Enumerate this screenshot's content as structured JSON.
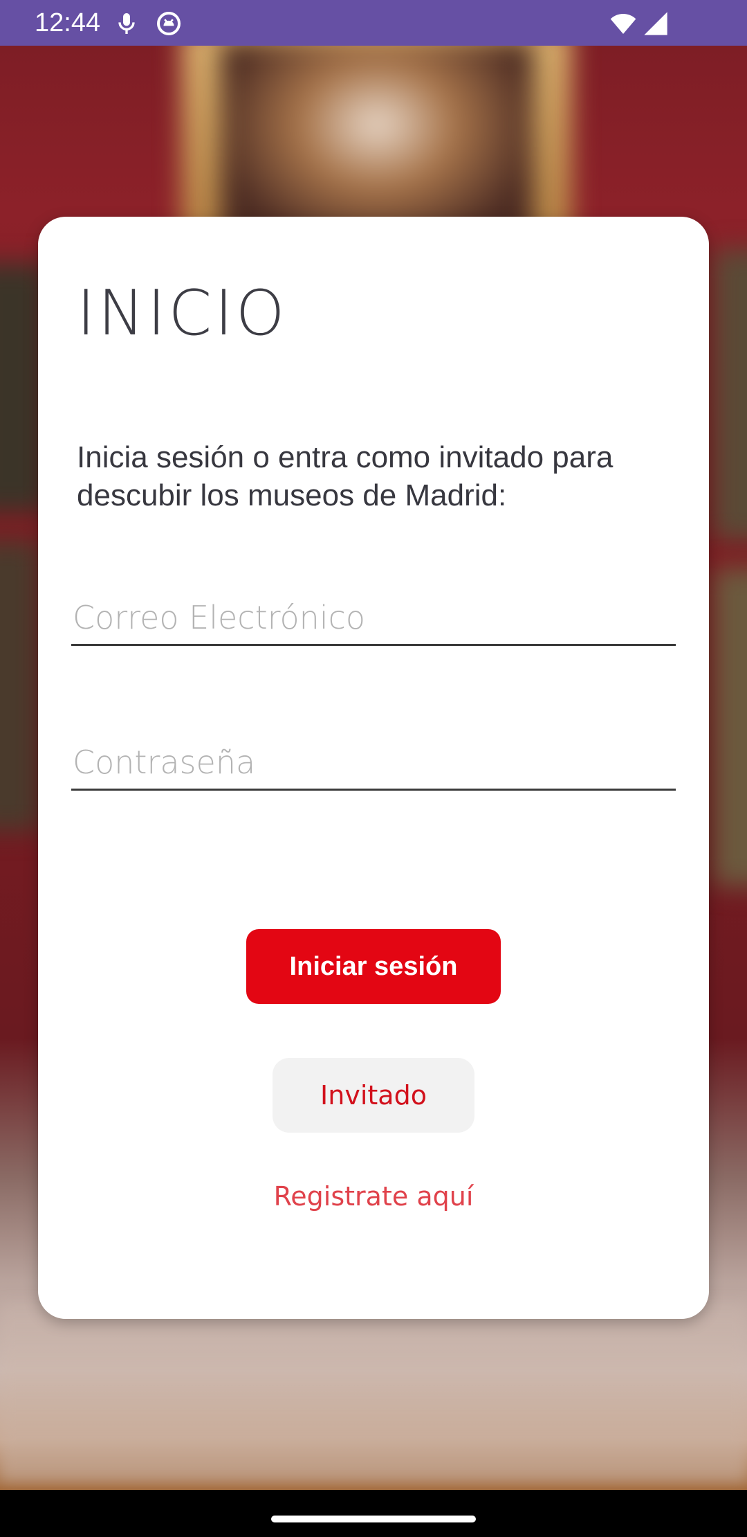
{
  "status_bar": {
    "time": "12:44",
    "bg_color": "#6650a4",
    "icons": [
      "microphone-icon",
      "android-debug-icon",
      "wifi-icon",
      "cellular-signal-icon"
    ]
  },
  "login_card": {
    "title": "INICIO",
    "subtitle": "Inicia sesión o entra como invitado para descubir los museos de Madrid:",
    "email_field": {
      "placeholder": "Correo Electrónico",
      "value": ""
    },
    "password_field": {
      "placeholder": "Contraseña",
      "value": ""
    },
    "login_button_label": "Iniciar sesión",
    "guest_button_label": "Invitado",
    "register_link_label": "Registrate aquí"
  },
  "colors": {
    "primary_red": "#e30613",
    "guest_text_red": "#d2111c",
    "link_red": "#e0424b",
    "title_gray": "#3d3d45"
  }
}
